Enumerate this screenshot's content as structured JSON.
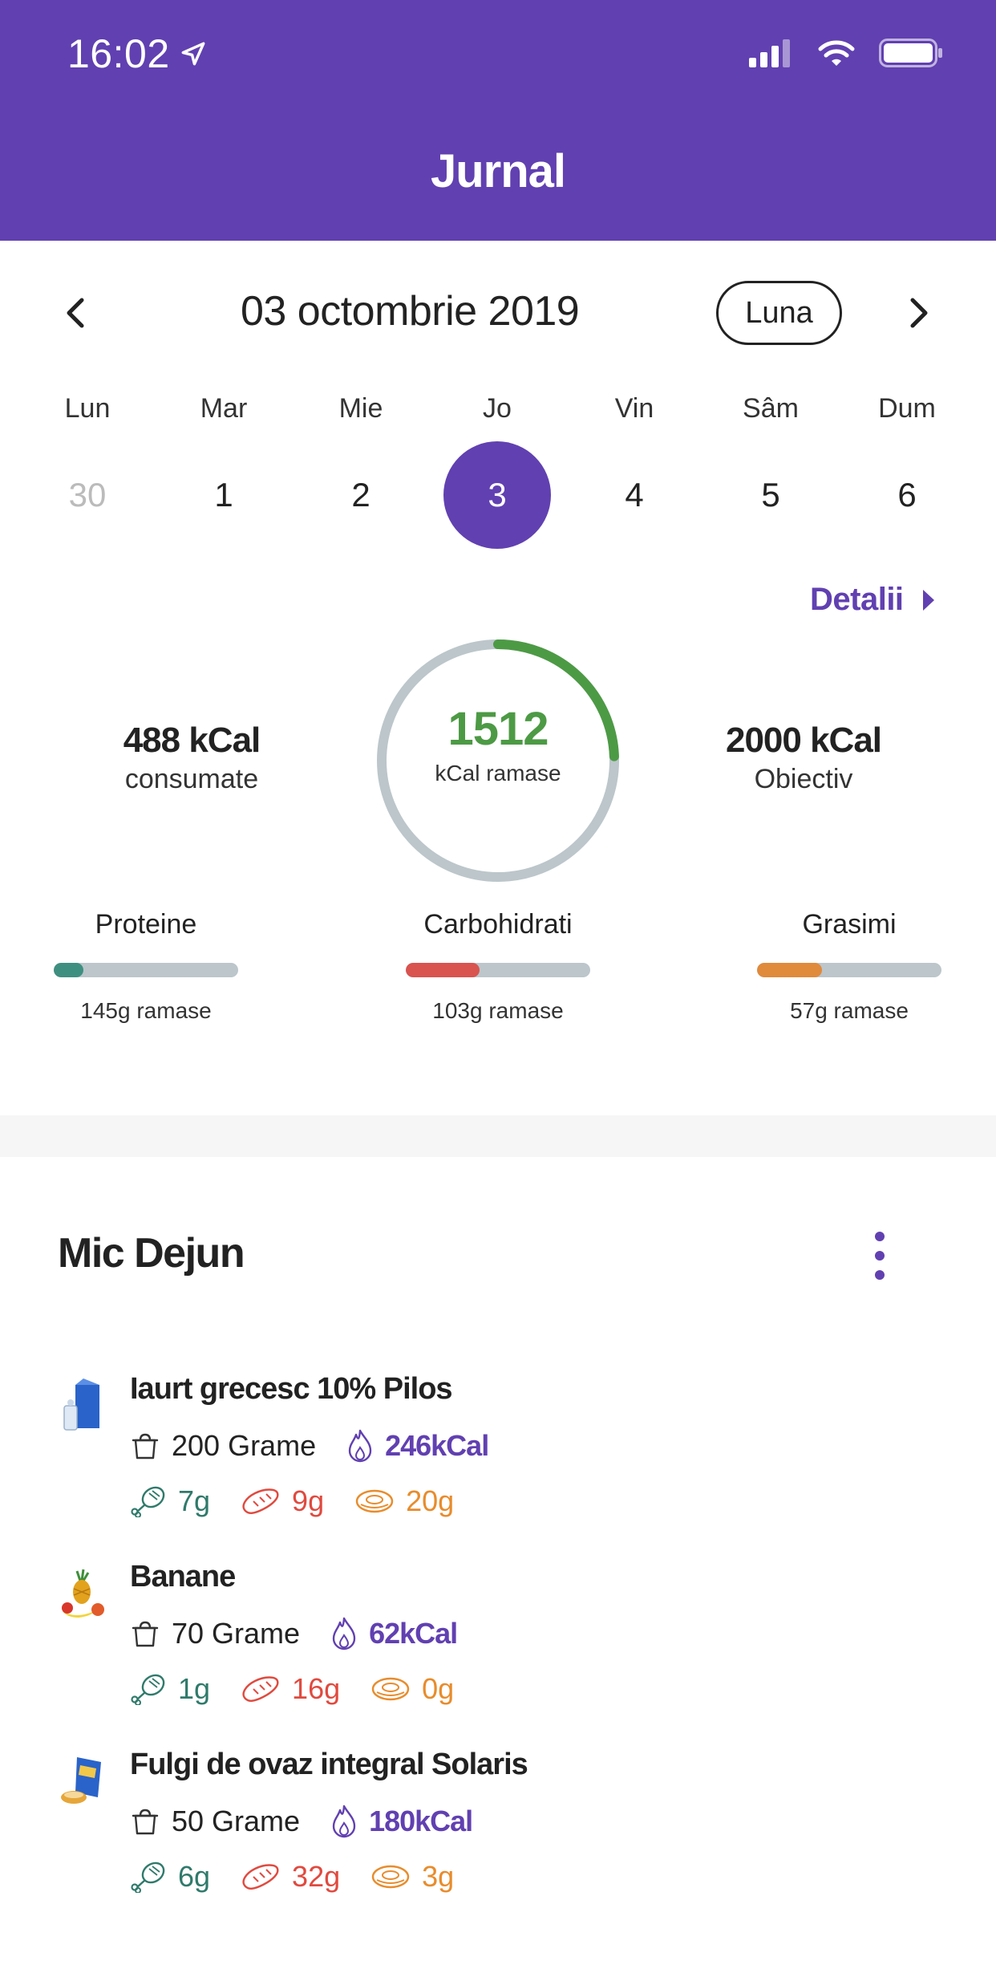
{
  "status": {
    "time": "16:02"
  },
  "header": {
    "title": "Jurnal"
  },
  "date_nav": {
    "date": "03 octombrie 2019",
    "view_button": "Luna"
  },
  "week": {
    "days": [
      "Lun",
      "Mar",
      "Mie",
      "Jo",
      "Vin",
      "Sâm",
      "Dum"
    ],
    "numbers": [
      "30",
      "1",
      "2",
      "3",
      "4",
      "5",
      "6"
    ],
    "selected_index": 3
  },
  "details_link": "Detalii",
  "summary": {
    "consumed_value": "488 kCal",
    "consumed_label": "consumate",
    "remaining_value": "1512",
    "remaining_label": "kCal ramase",
    "goal_value": "2000 kCal",
    "goal_label": "Obiectiv",
    "ring_progress": 0.244,
    "colors": {
      "ring": "#4d9a45",
      "track": "#bcc6cb"
    }
  },
  "macros": [
    {
      "name": "Proteine",
      "left": "145g ramase",
      "progress": 0.16,
      "color": "#3f8f80"
    },
    {
      "name": "Carbohidrati",
      "left": "103g ramase",
      "progress": 0.4,
      "color": "#d9534f"
    },
    {
      "name": "Grasimi",
      "left": "57g ramase",
      "progress": 0.35,
      "color": "#e08a3c"
    }
  ],
  "meal": {
    "title": "Mic Dejun",
    "items": [
      {
        "name": "Iaurt grecesc 10% Pilos",
        "amount": "200 Grame",
        "kcal": "246kCal",
        "protein": "7g",
        "carbs": "9g",
        "fat": "20g",
        "icon": "yogurt-icon"
      },
      {
        "name": "Banane",
        "amount": "70 Grame",
        "kcal": "62kCal",
        "protein": "1g",
        "carbs": "16g",
        "fat": "0g",
        "icon": "fruit-icon"
      },
      {
        "name": "Fulgi de ovaz integral Solaris",
        "amount": "50 Grame",
        "kcal": "180kCal",
        "protein": "6g",
        "carbs": "32g",
        "fat": "3g",
        "icon": "cereal-icon"
      }
    ]
  },
  "theme": {
    "accent": "#6140b1"
  }
}
